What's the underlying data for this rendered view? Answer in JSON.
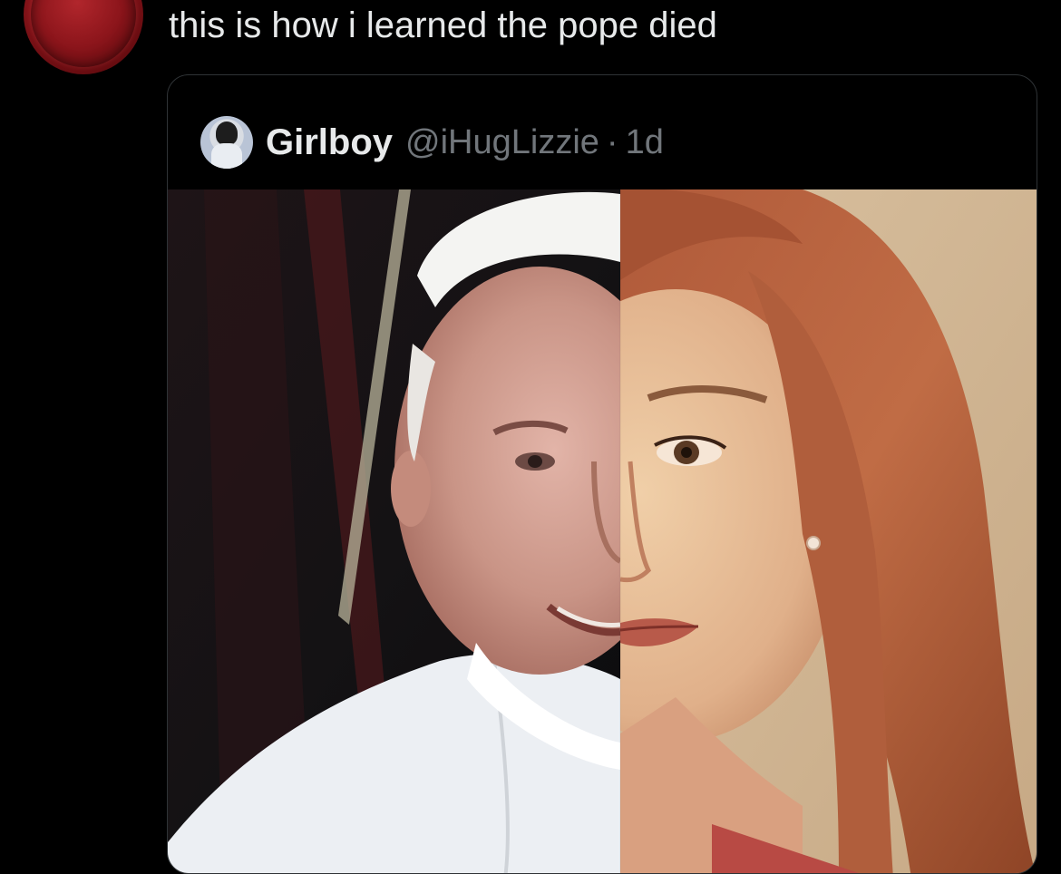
{
  "post": {
    "text": "this is how i learned the pope died",
    "avatar_icon": "red-wax-seal-icon"
  },
  "quote": {
    "display_name": "Girlboy",
    "handle": "@iHugLizzie",
    "separator": "·",
    "timestamp": "1d",
    "avatar_icon": "user-avatar-icon"
  },
  "media": {
    "description_icon": "split-face-photo"
  },
  "colors": {
    "background": "#000000",
    "text_primary": "#e7e9ea",
    "text_secondary": "#71767b",
    "border": "#2f3336",
    "seal_red": "#8c151b"
  }
}
